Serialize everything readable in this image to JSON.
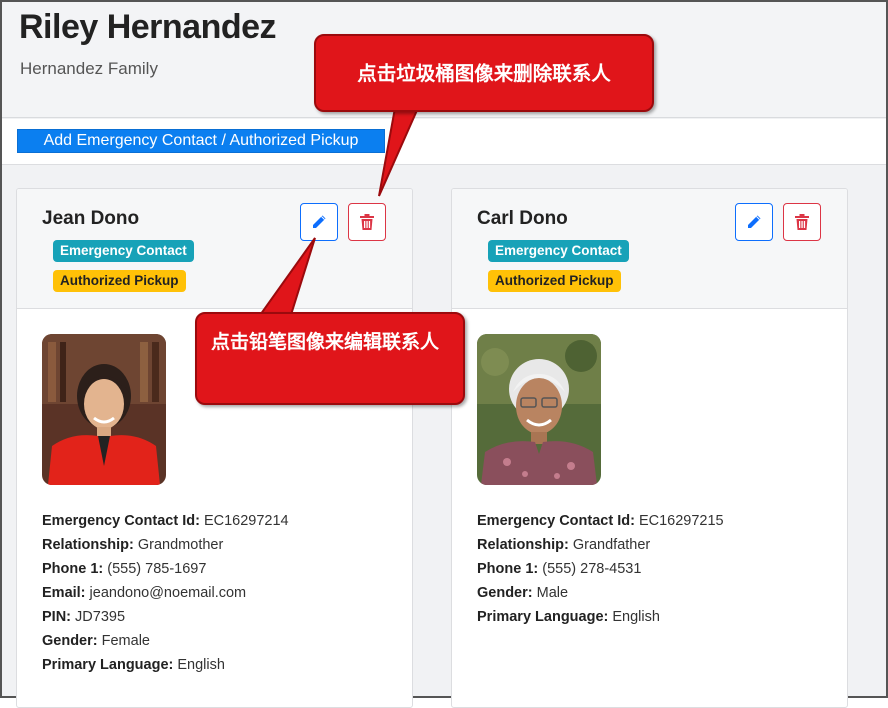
{
  "header": {
    "name": "Riley Hernandez",
    "family": "Hernandez Family"
  },
  "toolbar": {
    "add_label": "Add Emergency Contact / Authorized Pickup"
  },
  "contacts": [
    {
      "name": "Jean Dono",
      "badges": [
        "Emergency Contact",
        "Authorized Pickup"
      ],
      "fields": [
        {
          "label": "Emergency Contact Id:",
          "value": "EC16297214"
        },
        {
          "label": "Relationship:",
          "value": "Grandmother"
        },
        {
          "label": "Phone 1:",
          "value": "(555) 785-1697"
        },
        {
          "label": "Email:",
          "value": "jeandono@noemail.com"
        },
        {
          "label": "PIN:",
          "value": "JD7395"
        },
        {
          "label": "Gender:",
          "value": "Female"
        },
        {
          "label": "Primary Language:",
          "value": "English"
        }
      ]
    },
    {
      "name": "Carl Dono",
      "badges": [
        "Emergency Contact",
        "Authorized Pickup"
      ],
      "fields": [
        {
          "label": "Emergency Contact Id:",
          "value": "EC16297215"
        },
        {
          "label": "Relationship:",
          "value": "Grandfather"
        },
        {
          "label": "Phone 1:",
          "value": "(555) 278-4531"
        },
        {
          "label": "Gender:",
          "value": "Male"
        },
        {
          "label": "Primary Language:",
          "value": "English"
        }
      ]
    }
  ],
  "callouts": {
    "delete": "点击垃圾桶图像来删除联系人",
    "edit": "点击铅笔图像来编辑联系人"
  },
  "icons": {
    "edit": "pencil-icon",
    "delete": "trash-icon"
  },
  "colors": {
    "primary": "#0b7ff0",
    "badge_emergency": "#17a2b8",
    "badge_pickup": "#ffc107",
    "danger": "#dc3545",
    "callout": "#e0151a"
  }
}
